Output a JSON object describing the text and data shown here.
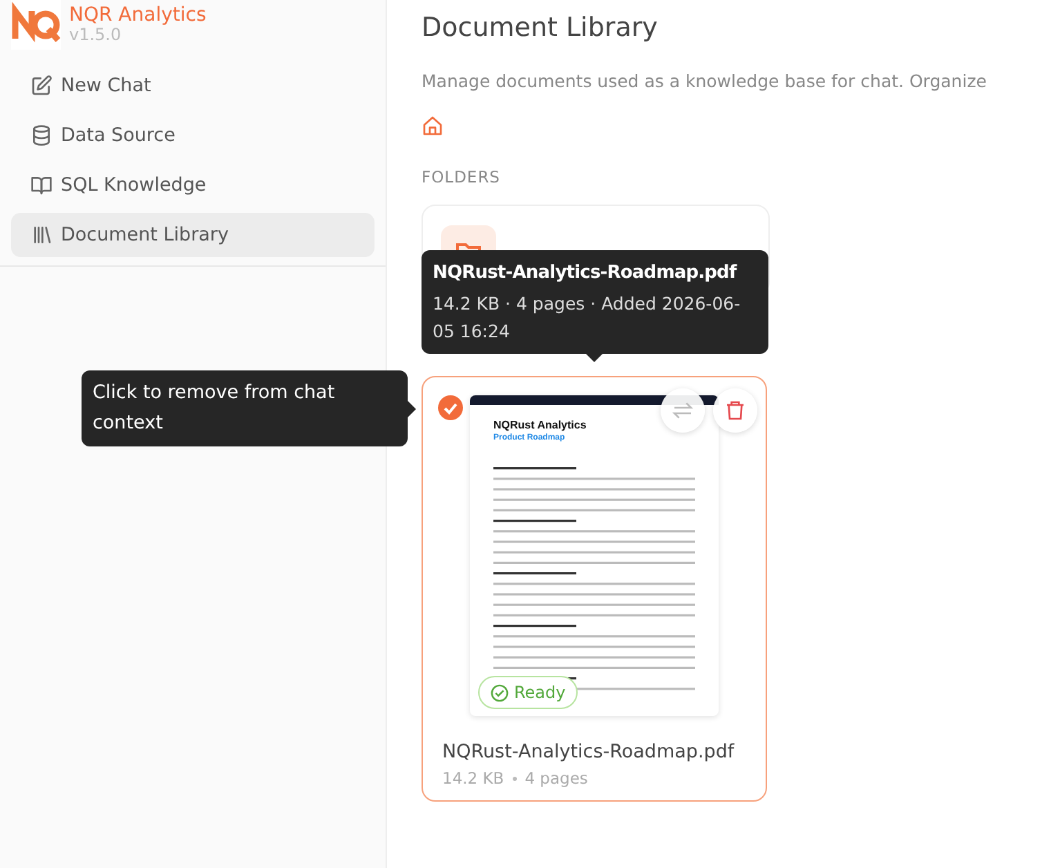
{
  "app": {
    "name": "NQR Analytics",
    "version": "v1.5.0"
  },
  "sidebar": {
    "items": [
      {
        "label": "New Chat",
        "selected": false
      },
      {
        "label": "Data Source",
        "selected": false
      },
      {
        "label": "SQL Knowledge",
        "selected": false
      },
      {
        "label": "Document Library",
        "selected": true
      }
    ]
  },
  "page": {
    "title": "Document Library",
    "description": "Manage documents used as a knowledge base for chat. Organize",
    "folders_heading": "FOLDERS"
  },
  "document": {
    "in_context": true,
    "name": "NQRust-Analytics-Roadmap.pdf",
    "size": "14.2 KB",
    "pages": "4 pages",
    "status": "Ready",
    "preview": {
      "title": "NQRust Analytics",
      "subtitle": "Product Roadmap"
    }
  },
  "tooltips": [
    {
      "kind": "file",
      "title": "NQRust-Analytics-Roadmap.pdf",
      "text": "14.2 KB · 4 pages · Added 2026-06-05 16:24"
    },
    {
      "kind": "context",
      "text": "Click to remove from chat context"
    }
  ]
}
